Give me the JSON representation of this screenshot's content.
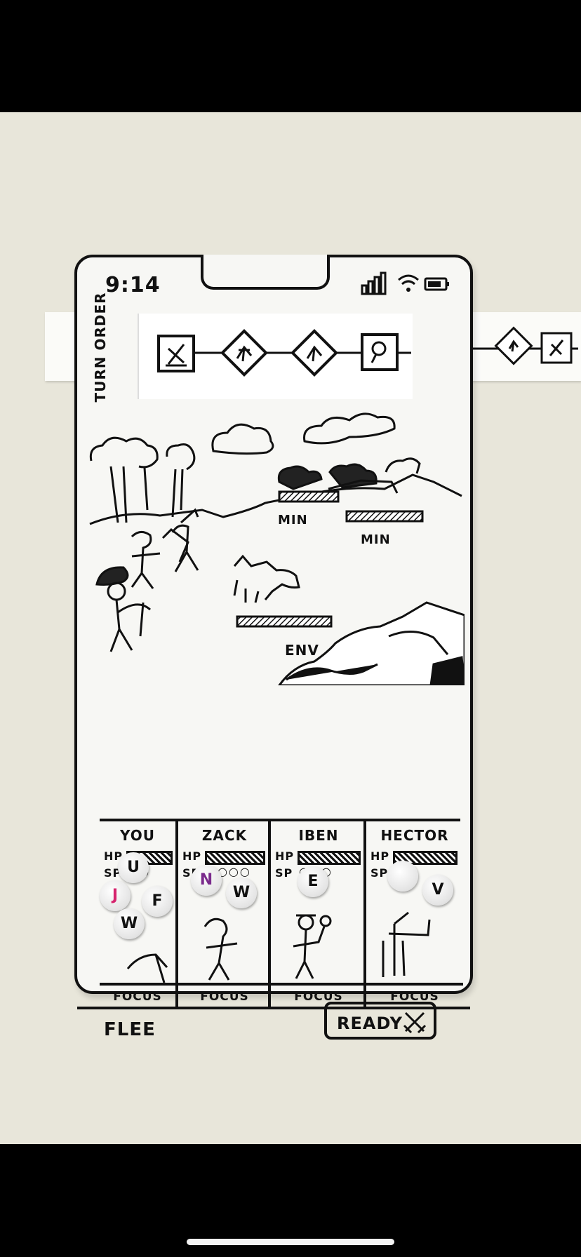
{
  "status_bar": {
    "time": "9:14"
  },
  "turn_order": {
    "label": "TURN ORDER",
    "icons": [
      "sword-icon",
      "runner-icon",
      "runner-icon",
      "magnifier-icon",
      "runner-icon",
      "sword-icon"
    ]
  },
  "scene": {
    "enemies": [
      {
        "label": "MIN"
      },
      {
        "label": "MIN"
      },
      {
        "label": "ENV"
      }
    ]
  },
  "party": [
    {
      "name": "YOU",
      "hp_label": "HP",
      "sp_label": "SP",
      "sp_dots": "○○",
      "action": "FOCUS",
      "beads": [
        "J",
        "U",
        "F",
        "W"
      ]
    },
    {
      "name": "ZACK",
      "hp_label": "HP",
      "sp_label": "SP",
      "sp_dots": "○○○○",
      "action": "FOCUS",
      "beads": [
        "N",
        "W"
      ]
    },
    {
      "name": "IBEN",
      "hp_label": "HP",
      "sp_label": "SP",
      "sp_dots": "○○○",
      "action": "FOCUS",
      "beads": [
        "E"
      ]
    },
    {
      "name": "HECTOR",
      "hp_label": "HP",
      "sp_label": "SP",
      "sp_dots": "○○",
      "action": "FOCUS",
      "beads": [
        "",
        "V"
      ]
    }
  ],
  "actions": {
    "flee": "FLEE",
    "ready": "READY"
  },
  "colors": {
    "ink": "#111111",
    "paper": "#f7f7f4",
    "table": "#e8e6da",
    "bead_pink": "#d6246e",
    "bead_purple": "#7a2a8c"
  }
}
